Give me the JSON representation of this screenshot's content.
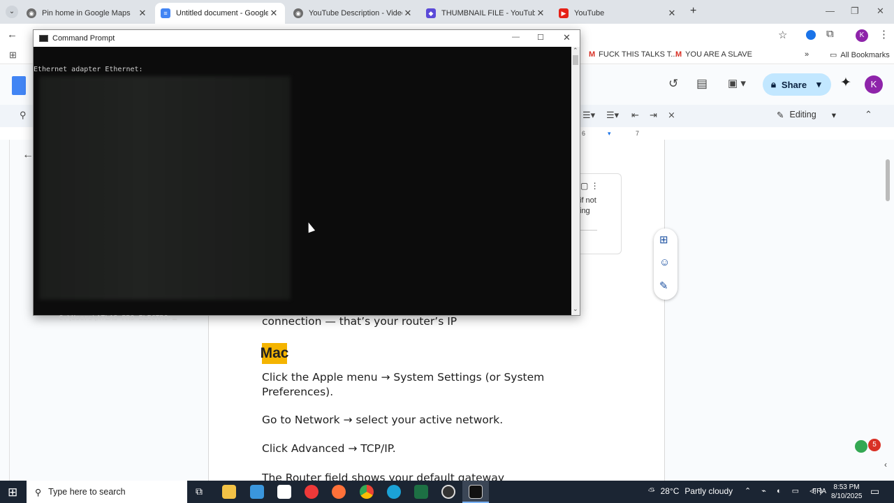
{
  "browser": {
    "tabs": [
      {
        "title": "Pin home in Google Maps",
        "active": false
      },
      {
        "title": "Untitled document - Google Do",
        "active": true
      },
      {
        "title": "YouTube Description - Video de",
        "active": false
      },
      {
        "title": "THUMBNAIL FILE - YouTube Th",
        "active": false
      },
      {
        "title": "YouTube",
        "active": false
      }
    ],
    "bookmarks": [
      {
        "label": "FUCK THIS TALKS T..."
      },
      {
        "label": "YOU ARE A SLAVE"
      }
    ],
    "all_bookmarks": "All Bookmarks",
    "profile_initial": "K"
  },
  "docs": {
    "share_label": "Share",
    "editing_label": "Editing",
    "ruler_6": "6",
    "ruler_7": "7",
    "comment_fragment_1": "if not",
    "comment_fragment_2": "ing",
    "text": {
      "line1": "connection — that’s your router’s IP",
      "mac_heading": "Mac",
      "p1": "Click the Apple menu → System Settings (or System Preferences).",
      "p2": "Go to Network → select your active network.",
      "p3": "Click Advanced → TCP/IP.",
      "p4": "The Router field shows your default gateway"
    }
  },
  "cmd": {
    "title": "Command Prompt",
    "adapter_line": "Ethernet adapter Ethernet:",
    "prompt": "C:\\Users\\ATLAS PRO ELECTRO>"
  },
  "taskbar": {
    "search_placeholder": "Type here to search",
    "weather_temp": "28°C",
    "weather_desc": "Partly cloudy",
    "language": "FRA",
    "time": "8:53 PM",
    "date": "8/10/2025"
  },
  "colors": {
    "accent_blue": "#0b57d0",
    "highlight": "#f4b400",
    "taskbar_bg": "#1b2533"
  }
}
